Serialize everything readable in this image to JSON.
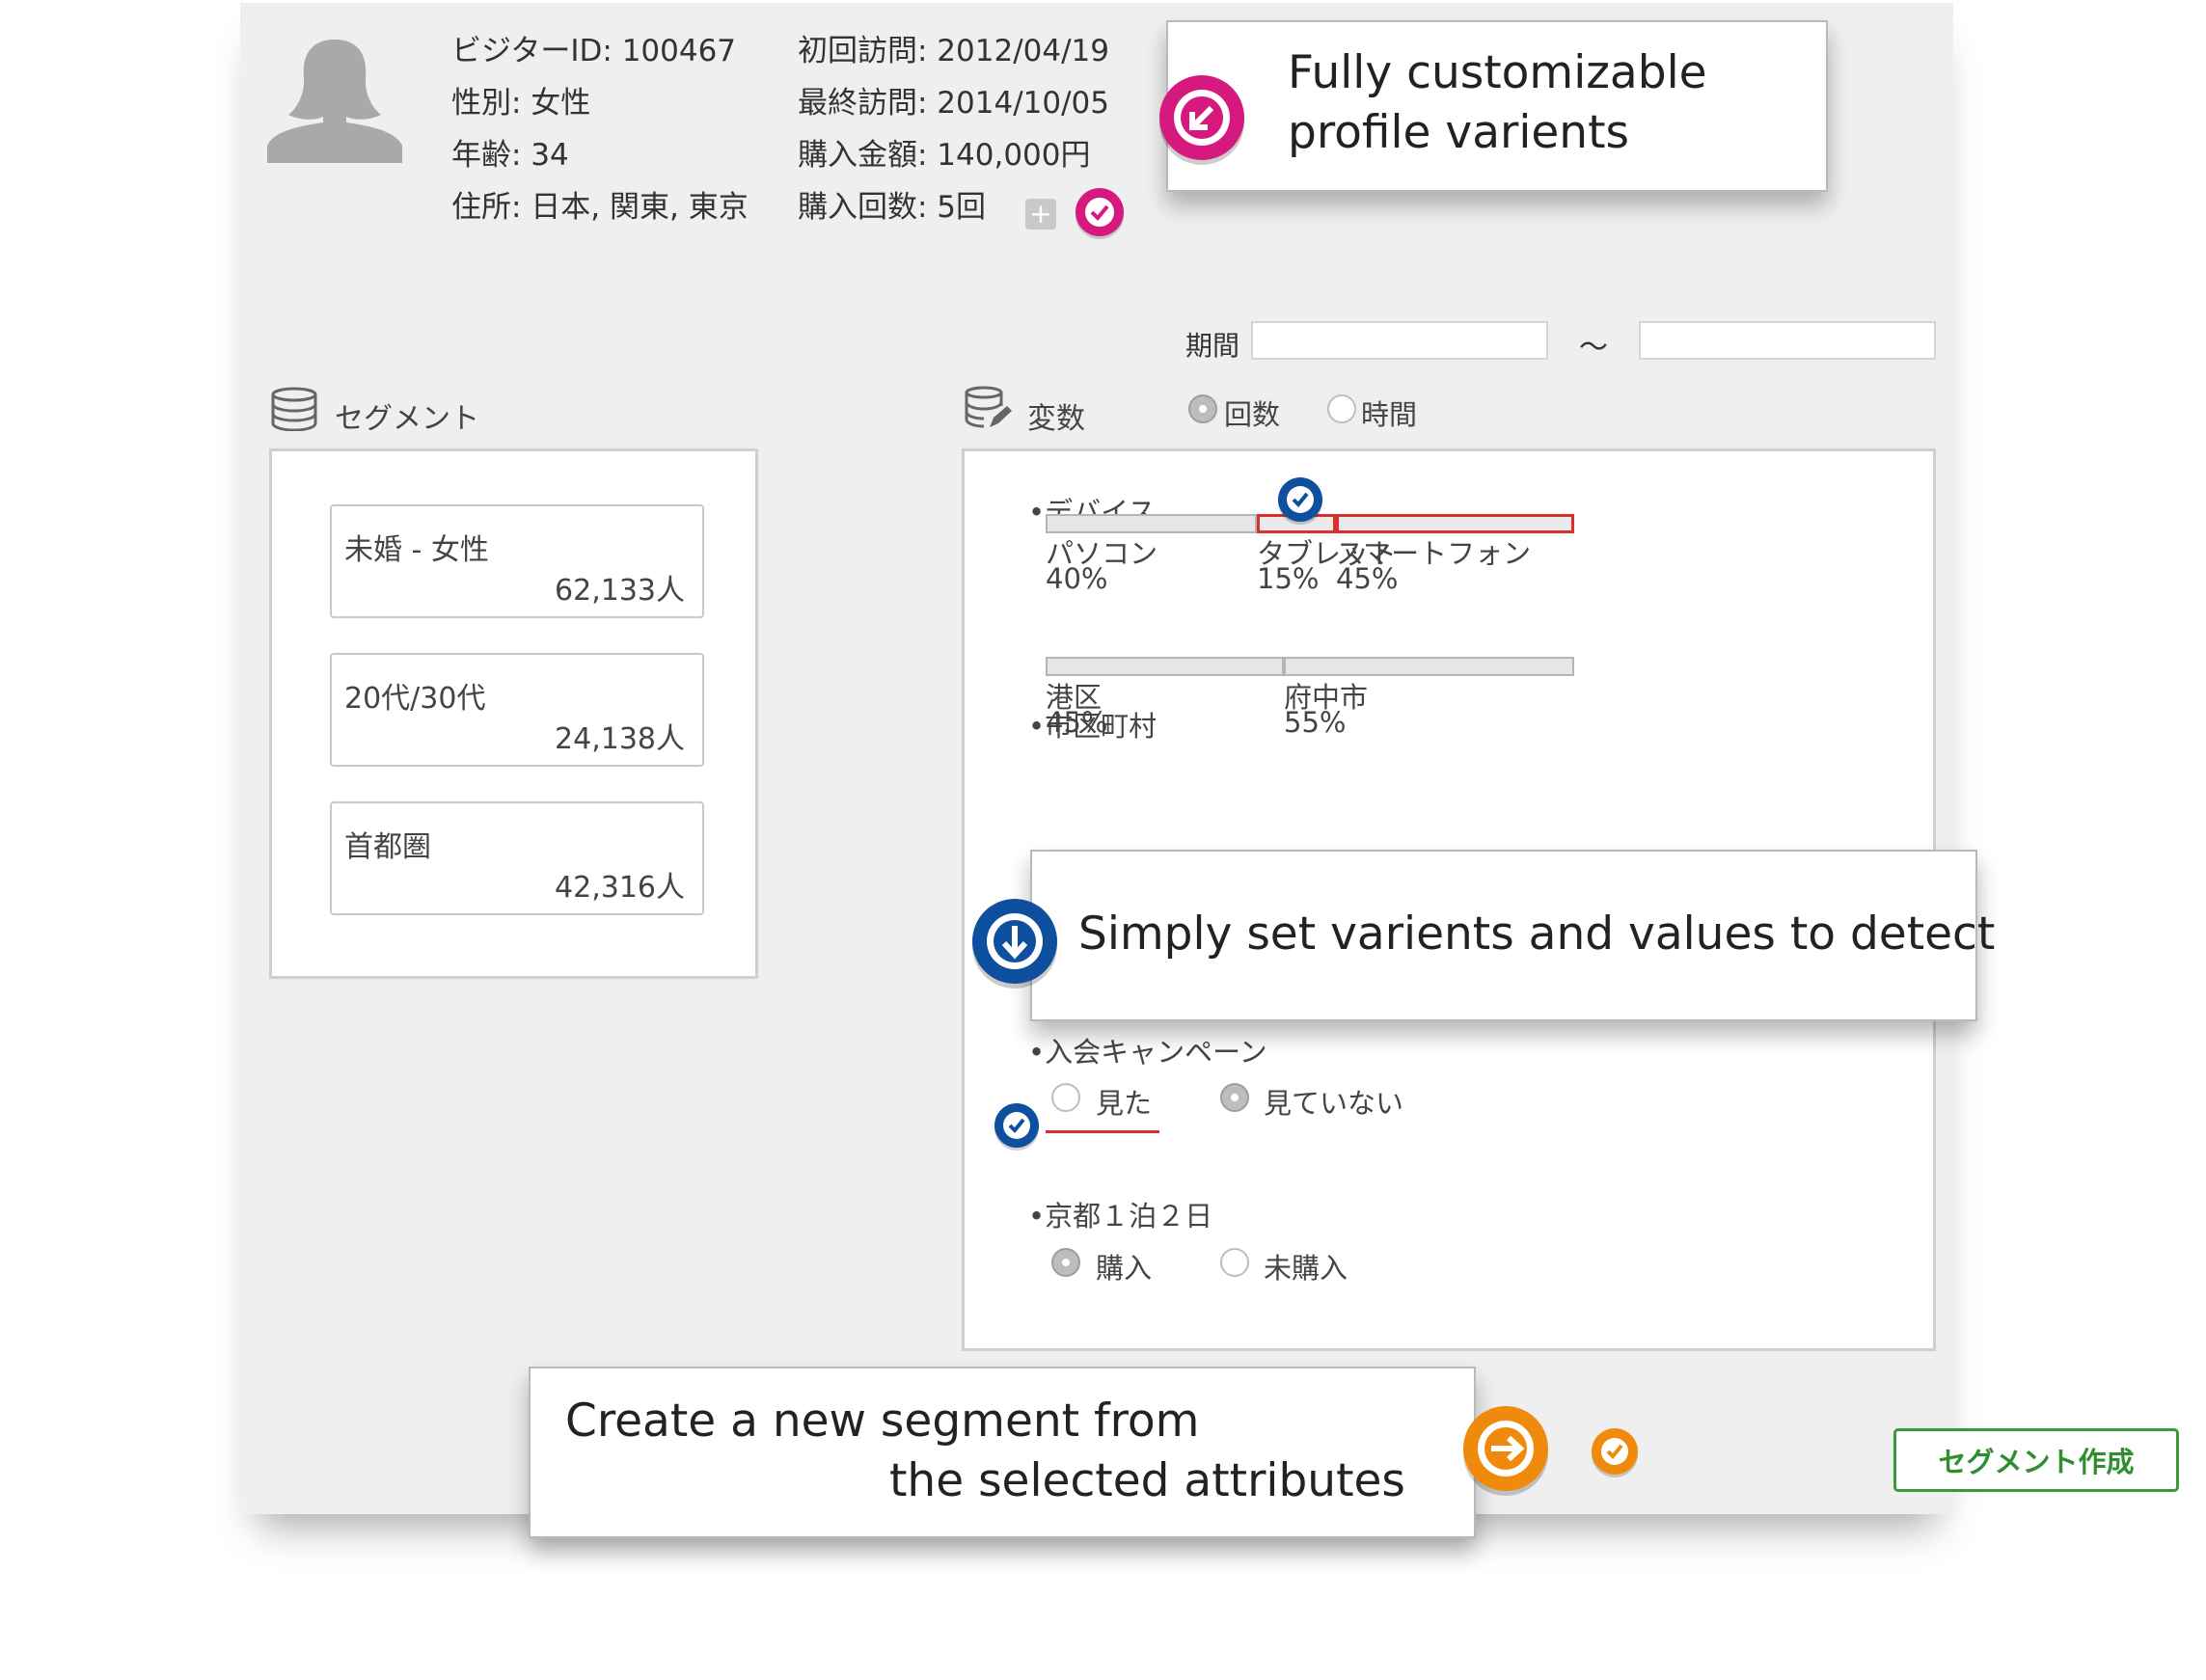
{
  "profile": {
    "visitor_id": "ビジターID: 100467",
    "gender": "性別: 女性",
    "age": "年齢: 34",
    "address": "住所: 日本, 関東, 東京",
    "first_visit": "初回訪問: 2012/04/19",
    "last_visit": "最終訪問: 2014/10/05",
    "purchase_amount": "購入金額: 140,000円",
    "purchase_count": "購入回数: 5回",
    "add_label": "+"
  },
  "period": {
    "label": "期間",
    "separator": "〜",
    "from_value": "",
    "to_value": ""
  },
  "segments": {
    "title": "セグメント",
    "items": [
      {
        "name": "未婚 - 女性",
        "count": "62,133人"
      },
      {
        "name": "20代/30代",
        "count": "24,138人"
      },
      {
        "name": "首都圏",
        "count": "42,316人"
      }
    ]
  },
  "variables": {
    "title": "変数",
    "mode_options": [
      {
        "label": "回数",
        "selected": true
      },
      {
        "label": "時間",
        "selected": false
      }
    ],
    "device": {
      "label": "•デバイス",
      "categories": [
        {
          "name": "パソコン",
          "percent": "40%",
          "value": 40,
          "selected": false
        },
        {
          "name": "タブレット",
          "percent": "15%",
          "value": 15,
          "selected": true
        },
        {
          "name": "スマートフォン",
          "percent": "45%",
          "value": 45,
          "selected": true
        }
      ]
    },
    "city": {
      "label": "•市区町村",
      "categories": [
        {
          "name": "港区",
          "percent": "45%",
          "value": 45
        },
        {
          "name": "府中市",
          "percent": "55%",
          "value": 55
        }
      ]
    },
    "campaign": {
      "label": "•入会キャンペーン",
      "options": [
        {
          "label": "見た",
          "selected": false
        },
        {
          "label": "見ていない",
          "selected": true
        }
      ]
    },
    "kyoto": {
      "label": "•京都１泊２日",
      "options": [
        {
          "label": "購入",
          "selected": true
        },
        {
          "label": "未購入",
          "selected": false
        }
      ]
    }
  },
  "callouts": {
    "profile": [
      "Fully customizable",
      "profile varients"
    ],
    "detect": "Simply set varients and values to detect",
    "create": [
      "Create a new segment from",
      "the selected attributes"
    ]
  },
  "create_button": "セグメント作成",
  "colors": {
    "magenta": "#d6197f",
    "blue": "#0e4fa0",
    "orange": "#f08a0c",
    "green": "#3a9a3a",
    "selected_border": "#d9302f"
  }
}
